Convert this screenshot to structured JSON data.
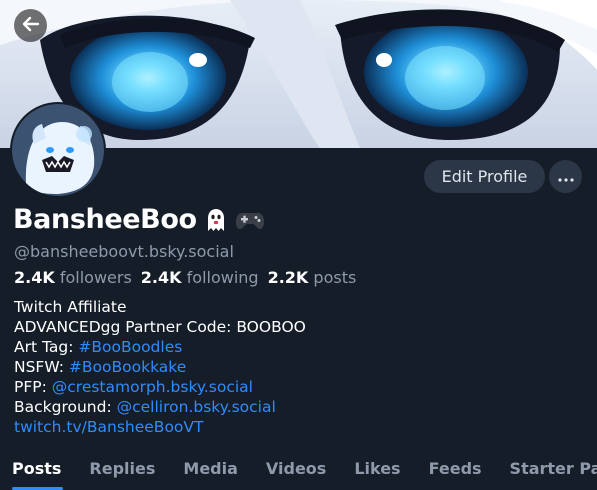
{
  "header": {
    "back_icon": "arrow-left-icon",
    "banner": "anime-eyes-banner-image"
  },
  "profile": {
    "avatar": "ghost-avatar-image",
    "display_name": "BansheeBoo",
    "name_emojis": [
      "ghost-emoji-icon",
      "gamepad-emoji-icon"
    ],
    "handle": "@bansheeboovt.bsky.social",
    "stats": [
      {
        "count": "2.4K",
        "label": "followers"
      },
      {
        "count": "2.4K",
        "label": "following"
      },
      {
        "count": "2.2K",
        "label": "posts"
      }
    ],
    "bio": {
      "line1": "Twitch Affiliate",
      "line2": "ADVANCEDgg Partner Code: BOOBOO",
      "art_prefix": "Art Tag: ",
      "art_link": "#BooBoodles",
      "nsfw_prefix": "NSFW: ",
      "nsfw_link": "#BooBookkake",
      "pfp_prefix": "PFP: ",
      "pfp_link": "@crestamorph.bsky.social",
      "bg_prefix": "Background: ",
      "bg_link": "@celliron.bsky.social",
      "twitch_link": "twitch.tv/BansheeBooVT"
    }
  },
  "actions": {
    "edit_profile": "Edit Profile",
    "more_icon": "more-horizontal-icon"
  },
  "tabs": [
    "Posts",
    "Replies",
    "Media",
    "Videos",
    "Likes",
    "Feeds",
    "Starter Pac"
  ],
  "colors": {
    "background": "#151d28",
    "accent": "#2f8cff",
    "muted": "#8e9aaa",
    "button": "#2b3646"
  }
}
